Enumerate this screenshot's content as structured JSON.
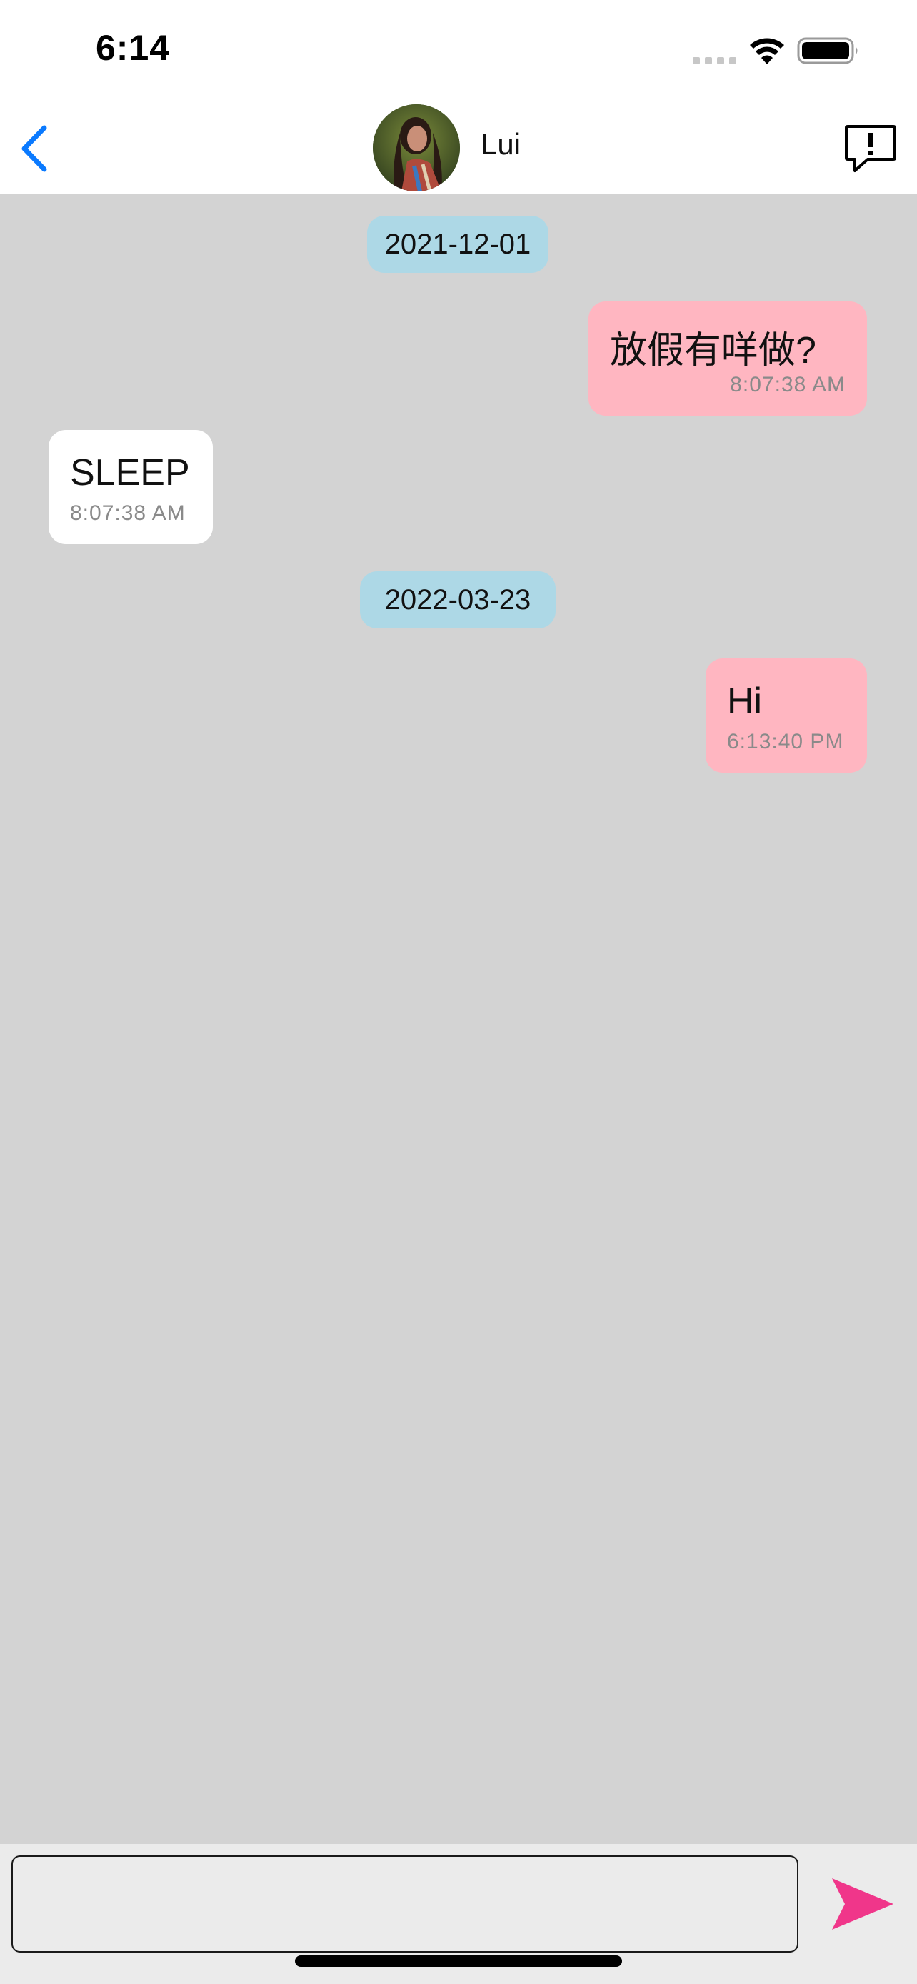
{
  "status_bar": {
    "time": "6:14",
    "signal_icon": "cellular-signal-icon",
    "wifi_icon": "wifi-icon",
    "battery_icon": "battery-icon"
  },
  "header": {
    "back_icon": "chevron-left-icon",
    "contact_name": "Lui",
    "avatar": "contact-avatar",
    "report_icon": "report-message-icon",
    "accent_color": "#0a7aff"
  },
  "chat": {
    "background_color": "#d3d3d3",
    "date_dividers": [
      "2021-12-01",
      "2022-03-23"
    ],
    "messages": [
      {
        "direction": "sent",
        "text": "放假有咩做?",
        "time": "8:07:38 AM"
      },
      {
        "direction": "received",
        "text": "SLEEP",
        "time": "8:07:38 AM"
      },
      {
        "direction": "sent",
        "text": "Hi",
        "time": "6:13:40 PM"
      }
    ],
    "sent_bubble_color": "#ffb6c1",
    "received_bubble_color": "#ffffff",
    "date_pill_color": "#add8e6"
  },
  "composer": {
    "input_value": "",
    "send_icon": "send-arrow-icon",
    "send_color": "#f0368a"
  }
}
